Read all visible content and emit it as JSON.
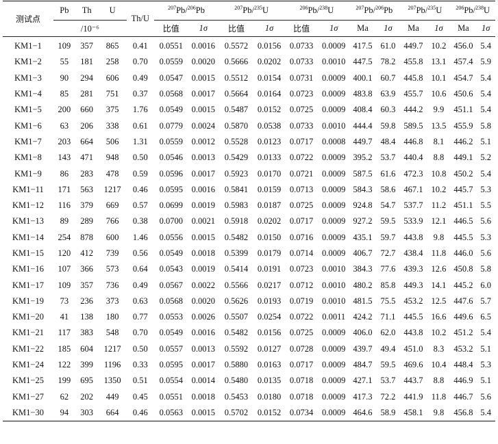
{
  "header": {
    "sample_label": "测试点",
    "pb": "Pb",
    "th": "Th",
    "u": "U",
    "conc_unit": "/10⁻⁶",
    "thu": "Th/U",
    "r1_pre": "207",
    "r1_mid": "Pb/",
    "r1_pre2": "206",
    "r1_end": "Pb",
    "r2_pre": "207",
    "r2_mid": "Pb/",
    "r2_pre2": "235",
    "r2_end": "U",
    "r3_pre": "206",
    "r3_mid": "Pb/",
    "r3_pre2": "238",
    "r3_end": "U",
    "ratio_label": "比值",
    "sigma_label": "1σ",
    "ma_label": "Ma"
  },
  "rows": [
    [
      "KM1−1",
      "109",
      "357",
      "865",
      "0.41",
      "0.0551",
      "0.0016",
      "0.5572",
      "0.0156",
      "0.0733",
      "0.0009",
      "417.5",
      "61.0",
      "449.7",
      "10.2",
      "456.0",
      "5.4"
    ],
    [
      "KM1−2",
      "55",
      "181",
      "258",
      "0.70",
      "0.0559",
      "0.0020",
      "0.5666",
      "0.0202",
      "0.0733",
      "0.0010",
      "447.5",
      "78.2",
      "455.8",
      "13.1",
      "457.4",
      "5.9"
    ],
    [
      "KM1−3",
      "90",
      "294",
      "606",
      "0.49",
      "0.0547",
      "0.0015",
      "0.5512",
      "0.0154",
      "0.0731",
      "0.0009",
      "400.1",
      "60.7",
      "445.8",
      "10.1",
      "454.7",
      "5.4"
    ],
    [
      "KM1−4",
      "85",
      "281",
      "751",
      "0.37",
      "0.0568",
      "0.0017",
      "0.5664",
      "0.0164",
      "0.0723",
      "0.0009",
      "483.8",
      "63.9",
      "455.7",
      "10.6",
      "450.6",
      "5.4"
    ],
    [
      "KM1−5",
      "200",
      "660",
      "375",
      "1.76",
      "0.0549",
      "0.0015",
      "0.5487",
      "0.0152",
      "0.0725",
      "0.0009",
      "408.4",
      "60.3",
      "444.2",
      "9.9",
      "451.1",
      "5.4"
    ],
    [
      "KM1−6",
      "63",
      "206",
      "338",
      "0.61",
      "0.0779",
      "0.0024",
      "0.5870",
      "0.0538",
      "0.0733",
      "0.0010",
      "444.4",
      "59.8",
      "589.5",
      "13.5",
      "455.9",
      "5.8"
    ],
    [
      "KM1−7",
      "203",
      "664",
      "506",
      "1.31",
      "0.0559",
      "0.0012",
      "0.5528",
      "0.0123",
      "0.0717",
      "0.0008",
      "449.7",
      "48.4",
      "446.8",
      "8.1",
      "446.2",
      "5.1"
    ],
    [
      "KM1−8",
      "143",
      "471",
      "948",
      "0.50",
      "0.0546",
      "0.0013",
      "0.5429",
      "0.0133",
      "0.0722",
      "0.0009",
      "395.2",
      "53.7",
      "440.4",
      "8.8",
      "449.1",
      "5.2"
    ],
    [
      "KM1−9",
      "86",
      "283",
      "478",
      "0.59",
      "0.0596",
      "0.0017",
      "0.5923",
      "0.0170",
      "0.0721",
      "0.0009",
      "587.5",
      "61.6",
      "472.3",
      "10.8",
      "450.2",
      "5.4"
    ],
    [
      "KM1−11",
      "171",
      "563",
      "1217",
      "0.46",
      "0.0595",
      "0.0016",
      "0.5841",
      "0.0159",
      "0.0713",
      "0.0009",
      "584.3",
      "58.6",
      "467.1",
      "10.2",
      "445.7",
      "5.3"
    ],
    [
      "KM1−12",
      "116",
      "379",
      "669",
      "0.57",
      "0.0699",
      "0.0019",
      "0.5983",
      "0.0187",
      "0.0725",
      "0.0009",
      "924.8",
      "54.7",
      "537.7",
      "11.2",
      "451.1",
      "5.5"
    ],
    [
      "KM1−13",
      "89",
      "289",
      "766",
      "0.38",
      "0.0700",
      "0.0021",
      "0.5918",
      "0.0202",
      "0.0717",
      "0.0009",
      "927.2",
      "59.5",
      "533.9",
      "12.1",
      "446.5",
      "5.6"
    ],
    [
      "KM1−14",
      "254",
      "878",
      "600",
      "1.46",
      "0.0556",
      "0.0015",
      "0.5482",
      "0.0150",
      "0.0716",
      "0.0009",
      "435.1",
      "59.7",
      "443.8",
      "9.8",
      "445.5",
      "5.3"
    ],
    [
      "KM1−15",
      "120",
      "412",
      "739",
      "0.56",
      "0.0549",
      "0.0018",
      "0.5399",
      "0.0179",
      "0.0714",
      "0.0009",
      "406.7",
      "72.7",
      "438.4",
      "11.8",
      "446.0",
      "5.6"
    ],
    [
      "KM1−16",
      "107",
      "366",
      "573",
      "0.64",
      "0.0543",
      "0.0019",
      "0.5414",
      "0.0191",
      "0.0723",
      "0.0010",
      "384.3",
      "77.6",
      "439.3",
      "12.6",
      "450.8",
      "5.8"
    ],
    [
      "KM1−17",
      "109",
      "357",
      "736",
      "0.49",
      "0.0567",
      "0.0022",
      "0.5566",
      "0.0217",
      "0.0712",
      "0.0010",
      "480.2",
      "85.8",
      "449.3",
      "14.1",
      "445.2",
      "6.0"
    ],
    [
      "KM1−19",
      "73",
      "236",
      "373",
      "0.63",
      "0.0568",
      "0.0020",
      "0.5626",
      "0.0193",
      "0.0719",
      "0.0010",
      "481.5",
      "75.5",
      "453.2",
      "12.5",
      "447.6",
      "5.7"
    ],
    [
      "KM1−20",
      "41",
      "138",
      "180",
      "0.77",
      "0.0553",
      "0.0026",
      "0.5507",
      "0.0254",
      "0.0722",
      "0.0011",
      "424.2",
      "71.1",
      "445.5",
      "16.6",
      "449.6",
      "6.5"
    ],
    [
      "KM1−21",
      "117",
      "383",
      "548",
      "0.70",
      "0.0549",
      "0.0016",
      "0.5482",
      "0.0156",
      "0.0725",
      "0.0009",
      "406.0",
      "62.0",
      "443.8",
      "10.2",
      "451.2",
      "5.4"
    ],
    [
      "KM1−22",
      "185",
      "604",
      "1217",
      "0.50",
      "0.0557",
      "0.0013",
      "0.5592",
      "0.0127",
      "0.0728",
      "0.0009",
      "439.7",
      "49.4",
      "451.0",
      "8.3",
      "453.2",
      "5.1"
    ],
    [
      "KM1−24",
      "122",
      "399",
      "1196",
      "0.33",
      "0.0595",
      "0.0017",
      "0.5880",
      "0.0163",
      "0.0717",
      "0.0009",
      "484.7",
      "59.5",
      "469.6",
      "10.4",
      "448.4",
      "5.3"
    ],
    [
      "KM1−25",
      "199",
      "695",
      "1350",
      "0.51",
      "0.0554",
      "0.0014",
      "0.5480",
      "0.0135",
      "0.0718",
      "0.0009",
      "427.1",
      "53.7",
      "443.7",
      "8.8",
      "446.9",
      "5.1"
    ],
    [
      "KM1−27",
      "62",
      "202",
      "449",
      "0.45",
      "0.0551",
      "0.0018",
      "0.5453",
      "0.0180",
      "0.0718",
      "0.0009",
      "417.3",
      "72.2",
      "441.9",
      "11.8",
      "446.7",
      "5.6"
    ],
    [
      "KM1−30",
      "94",
      "303",
      "664",
      "0.46",
      "0.0563",
      "0.0015",
      "0.5702",
      "0.0152",
      "0.0734",
      "0.0009",
      "464.6",
      "58.9",
      "458.1",
      "9.8",
      "456.8",
      "5.4"
    ]
  ]
}
